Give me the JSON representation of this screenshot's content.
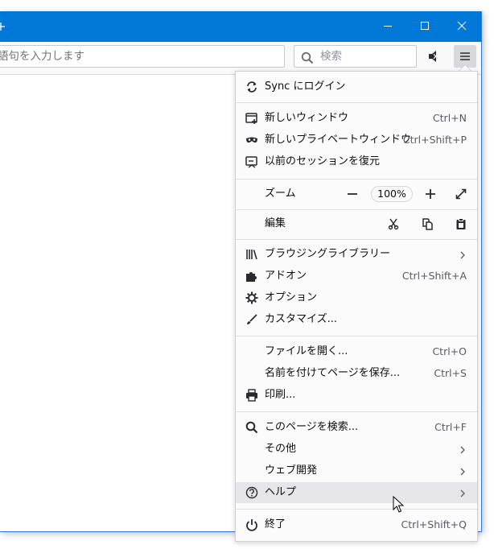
{
  "toolbar": {
    "url_placeholder": "語句を入力します",
    "search_placeholder": "検索"
  },
  "menu": {
    "sync": "Sync にログイン",
    "new_window": {
      "label": "新しいウィンドウ",
      "shortcut": "Ctrl+N"
    },
    "private_window": {
      "label": "新しいプライベートウィンドウ",
      "shortcut": "Ctrl+Shift+P"
    },
    "restore_session": "以前のセッションを復元",
    "zoom": {
      "label": "ズーム",
      "value": "100%"
    },
    "edit": "編集",
    "library": "ブラウジングライブラリー",
    "addons": {
      "label": "アドオン",
      "shortcut": "Ctrl+Shift+A"
    },
    "options": "オプション",
    "customize": "カスタマイズ...",
    "open_file": {
      "label": "ファイルを開く...",
      "shortcut": "Ctrl+O"
    },
    "save_page": {
      "label": "名前を付けてページを保存...",
      "shortcut": "Ctrl+S"
    },
    "print": "印刷...",
    "find": {
      "label": "このページを検索...",
      "shortcut": "Ctrl+F"
    },
    "more": "その他",
    "web_developer": "ウェブ開発",
    "help": "ヘルプ",
    "quit": {
      "label": "終了",
      "shortcut": "Ctrl+Shift+Q"
    }
  }
}
